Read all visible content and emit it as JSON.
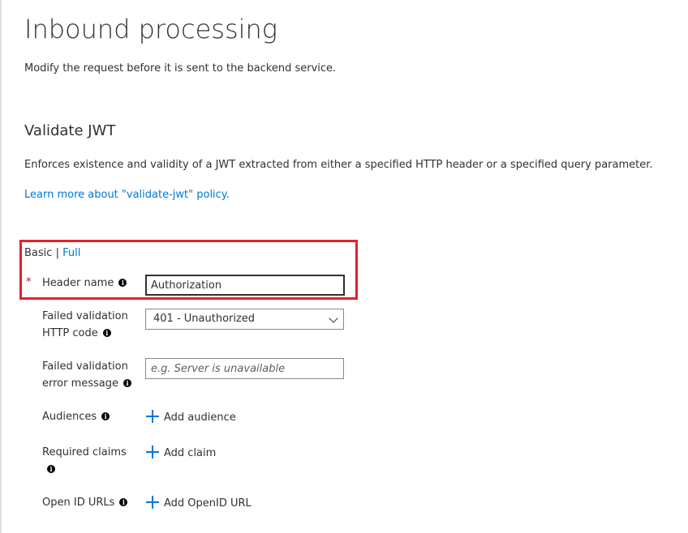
{
  "page": {
    "title": "Inbound processing",
    "description": "Modify the request before it is sent to the backend service."
  },
  "section": {
    "title": "Validate JWT",
    "description": "Enforces existence and validity of a JWT extracted from either a specified HTTP header or a specified query parameter.",
    "learn_more": "Learn more about \"validate-jwt\" policy."
  },
  "mode": {
    "basic": "Basic",
    "separator": "|",
    "full": "Full"
  },
  "icons": {
    "info": "info-icon",
    "plus": "plus-icon",
    "chevron": "chevron-down-icon"
  },
  "colors": {
    "link": "#0078d4",
    "highlight": "#e5202e",
    "required": "#a4262c"
  },
  "form": {
    "required_marker": "*",
    "header_name": {
      "label": "Header name",
      "value": "Authorization"
    },
    "failed_code": {
      "label_line1": "Failed validation",
      "label_line2": "HTTP code",
      "value": "401 - Unauthorized"
    },
    "failed_message": {
      "label_line1": "Failed validation",
      "label_line2": "error message",
      "placeholder": "e.g. Server is unavailable"
    },
    "audiences": {
      "label": "Audiences",
      "button": "Add audience"
    },
    "required_claims": {
      "label": "Required claims",
      "button": "Add claim"
    },
    "openid_urls": {
      "label": "Open ID URLs",
      "button": "Add OpenID URL"
    }
  }
}
